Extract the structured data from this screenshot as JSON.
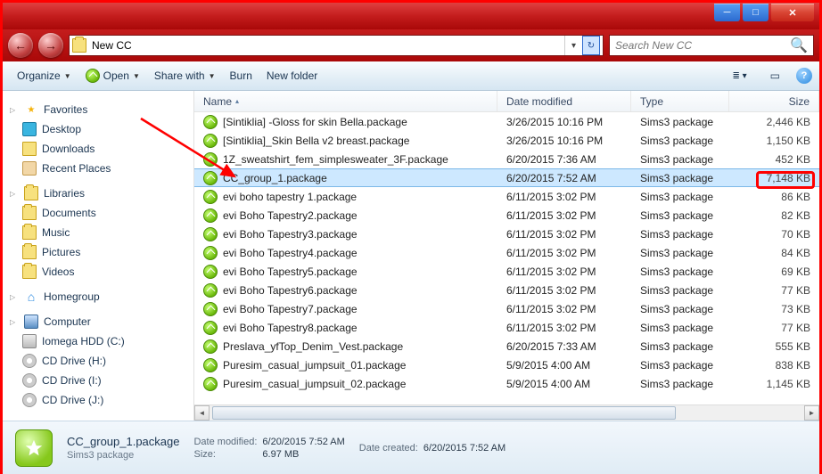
{
  "address": {
    "folder_name": "New CC"
  },
  "search": {
    "placeholder": "Search New CC"
  },
  "toolbar": {
    "organize": "Organize",
    "open": "Open",
    "share": "Share with",
    "burn": "Burn",
    "newfolder": "New folder"
  },
  "sidebar": {
    "favorites": {
      "label": "Favorites",
      "items": [
        "Desktop",
        "Downloads",
        "Recent Places"
      ]
    },
    "libraries": {
      "label": "Libraries",
      "items": [
        "Documents",
        "Music",
        "Pictures",
        "Videos"
      ]
    },
    "homegroup": {
      "label": "Homegroup"
    },
    "computer": {
      "label": "Computer",
      "items": [
        "Iomega HDD (C:)",
        "CD Drive (H:)",
        "CD Drive (I:)",
        "CD Drive (J:)"
      ]
    }
  },
  "columns": {
    "name": "Name",
    "date": "Date modified",
    "type": "Type",
    "size": "Size"
  },
  "files": [
    {
      "name": "[Sintiklia] -Gloss for skin Bella.package",
      "date": "3/26/2015 10:16 PM",
      "type": "Sims3 package",
      "size": "2,446 KB",
      "sel": false
    },
    {
      "name": "[Sintiklia]_Skin Bella v2 breast.package",
      "date": "3/26/2015 10:16 PM",
      "type": "Sims3 package",
      "size": "1,150 KB",
      "sel": false
    },
    {
      "name": "1Z_sweatshirt_fem_simplesweater_3F.package",
      "date": "6/20/2015 7:36 AM",
      "type": "Sims3 package",
      "size": "452 KB",
      "sel": false
    },
    {
      "name": "CC_group_1.package",
      "date": "6/20/2015 7:52 AM",
      "type": "Sims3 package",
      "size": "7,148 KB",
      "sel": true
    },
    {
      "name": "evi boho tapestry 1.package",
      "date": "6/11/2015 3:02 PM",
      "type": "Sims3 package",
      "size": "86 KB",
      "sel": false
    },
    {
      "name": "evi Boho Tapestry2.package",
      "date": "6/11/2015 3:02 PM",
      "type": "Sims3 package",
      "size": "82 KB",
      "sel": false
    },
    {
      "name": "evi Boho Tapestry3.package",
      "date": "6/11/2015 3:02 PM",
      "type": "Sims3 package",
      "size": "70 KB",
      "sel": false
    },
    {
      "name": "evi Boho Tapestry4.package",
      "date": "6/11/2015 3:02 PM",
      "type": "Sims3 package",
      "size": "84 KB",
      "sel": false
    },
    {
      "name": "evi Boho Tapestry5.package",
      "date": "6/11/2015 3:02 PM",
      "type": "Sims3 package",
      "size": "69 KB",
      "sel": false
    },
    {
      "name": "evi Boho Tapestry6.package",
      "date": "6/11/2015 3:02 PM",
      "type": "Sims3 package",
      "size": "77 KB",
      "sel": false
    },
    {
      "name": "evi Boho Tapestry7.package",
      "date": "6/11/2015 3:02 PM",
      "type": "Sims3 package",
      "size": "73 KB",
      "sel": false
    },
    {
      "name": "evi Boho Tapestry8.package",
      "date": "6/11/2015 3:02 PM",
      "type": "Sims3 package",
      "size": "77 KB",
      "sel": false
    },
    {
      "name": "Preslava_yfTop_Denim_Vest.package",
      "date": "6/20/2015 7:33 AM",
      "type": "Sims3 package",
      "size": "555 KB",
      "sel": false
    },
    {
      "name": "Puresim_casual_jumpsuit_01.package",
      "date": "5/9/2015 4:00 AM",
      "type": "Sims3 package",
      "size": "838 KB",
      "sel": false
    },
    {
      "name": "Puresim_casual_jumpsuit_02.package",
      "date": "5/9/2015 4:00 AM",
      "type": "Sims3 package",
      "size": "1,145 KB",
      "sel": false
    }
  ],
  "details": {
    "filename": "CC_group_1.package",
    "filetype": "Sims3 package",
    "mod_label": "Date modified:",
    "mod_value": "6/20/2015 7:52 AM",
    "size_label": "Size:",
    "size_value": "6.97 MB",
    "created_label": "Date created:",
    "created_value": "6/20/2015 7:52 AM"
  }
}
